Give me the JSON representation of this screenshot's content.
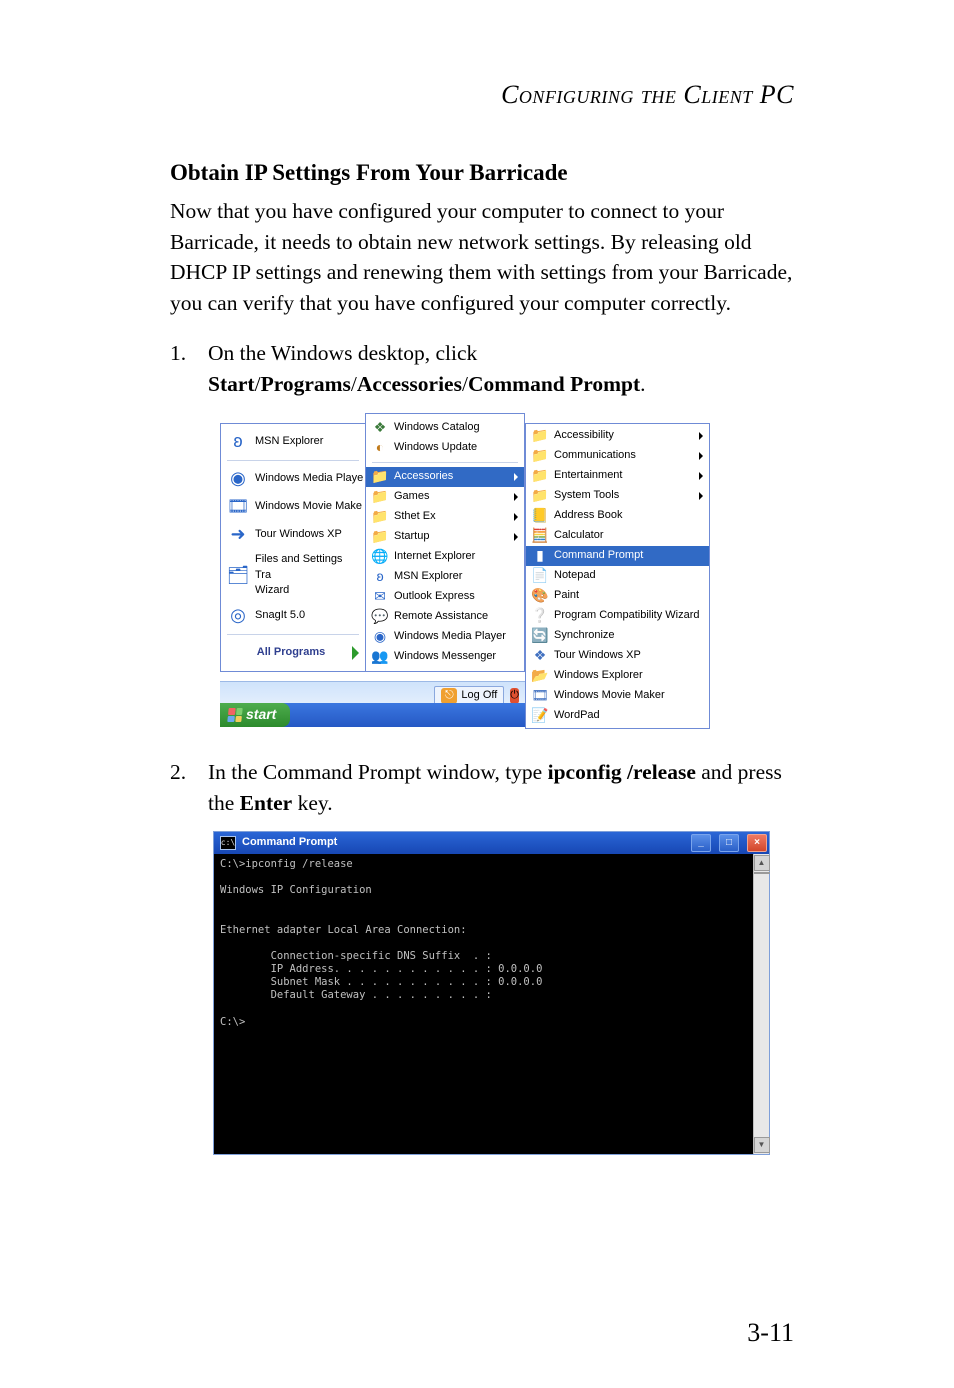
{
  "running_head": "Configuring the Client PC",
  "section_title": "Obtain IP Settings From Your Barricade",
  "intro": "Now that you have configured your computer to connect to your Barricade, it needs to obtain new network settings. By releasing old DHCP IP settings and renewing them with settings from your Barricade, you can verify that you have configured your computer correctly.",
  "step1": {
    "pre": "On the Windows desktop, click ",
    "b1": "Start",
    "s1": "/",
    "b2": "Programs",
    "s2": "/",
    "b3": "Accessories",
    "s3": "/",
    "b4": "Command Prompt",
    "post": "."
  },
  "step2": {
    "pre": "In the Command Prompt window, type ",
    "b1": "ipconfig /release",
    "mid": " and press the ",
    "b2": "Enter",
    "post": " key."
  },
  "start_menu": {
    "left": [
      "MSN Explorer",
      "Windows Media Playe",
      "Windows Movie Make",
      "Tour Windows XP",
      "Files and Settings Tra\nWizard",
      "SnagIt 5.0"
    ],
    "all_programs": "All Programs",
    "logoff": "Log Off",
    "start": "start",
    "mid_top": [
      "Windows Catalog",
      "Windows Update"
    ],
    "mid": [
      "Accessories",
      "Games",
      "Sthet Ex",
      "Startup",
      "Internet Explorer",
      "MSN Explorer",
      "Outlook Express",
      "Remote Assistance",
      "Windows Media Player",
      "Windows Messenger"
    ],
    "mid_sub_indices": [
      0,
      1,
      2,
      3
    ],
    "mid_hl_index": 0,
    "right": [
      "Accessibility",
      "Communications",
      "Entertainment",
      "System Tools",
      "Address Book",
      "Calculator",
      "Command Prompt",
      "Notepad",
      "Paint",
      "Program Compatibility Wizard",
      "Synchronize",
      "Tour Windows XP",
      "Windows Explorer",
      "Windows Movie Maker",
      "WordPad"
    ],
    "right_sub_indices": [
      0,
      1,
      2,
      3
    ],
    "right_hl_index": 6
  },
  "cmd": {
    "title": "Command Prompt",
    "body": "C:\\>ipconfig /release\n\nWindows IP Configuration\n\n\nEthernet adapter Local Area Connection:\n\n        Connection-specific DNS Suffix  . :\n        IP Address. . . . . . . . . . . . : 0.0.0.0\n        Subnet Mask . . . . . . . . . . . : 0.0.0.0\n        Default Gateway . . . . . . . . . :\n\nC:\\>"
  },
  "page_number": "3-11"
}
